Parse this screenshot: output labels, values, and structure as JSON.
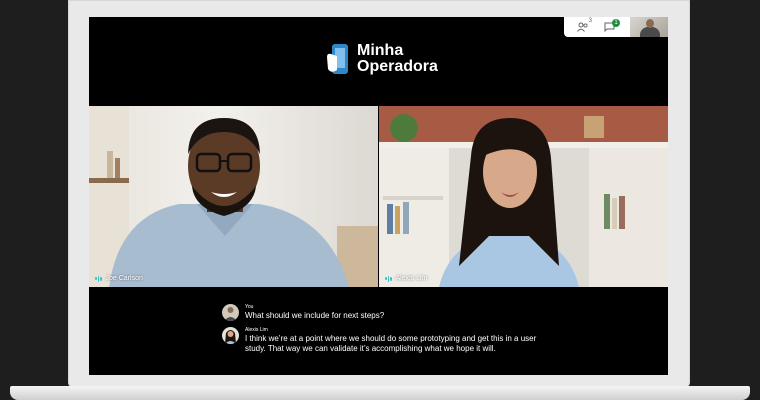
{
  "brand": {
    "line1": "Minha",
    "line2": "Operadora"
  },
  "topbar": {
    "participants_count": "3",
    "chat_badge": "1"
  },
  "tiles": [
    {
      "name": "Joe Carlson"
    },
    {
      "name": "Alexis Lim"
    }
  ],
  "captions": [
    {
      "speaker": "You",
      "text": "What should we include for next steps?"
    },
    {
      "speaker": "Alexis Lim",
      "text": "I think we’re at a point where we should do some prototyping and get this in a user study. That way we can validate it’s accomplishing what we hope it will."
    }
  ],
  "colors": {
    "mic_wave": "#3cc4c4",
    "chat_badge": "#1e8e3e",
    "logo_blue": "#2f86c8"
  }
}
